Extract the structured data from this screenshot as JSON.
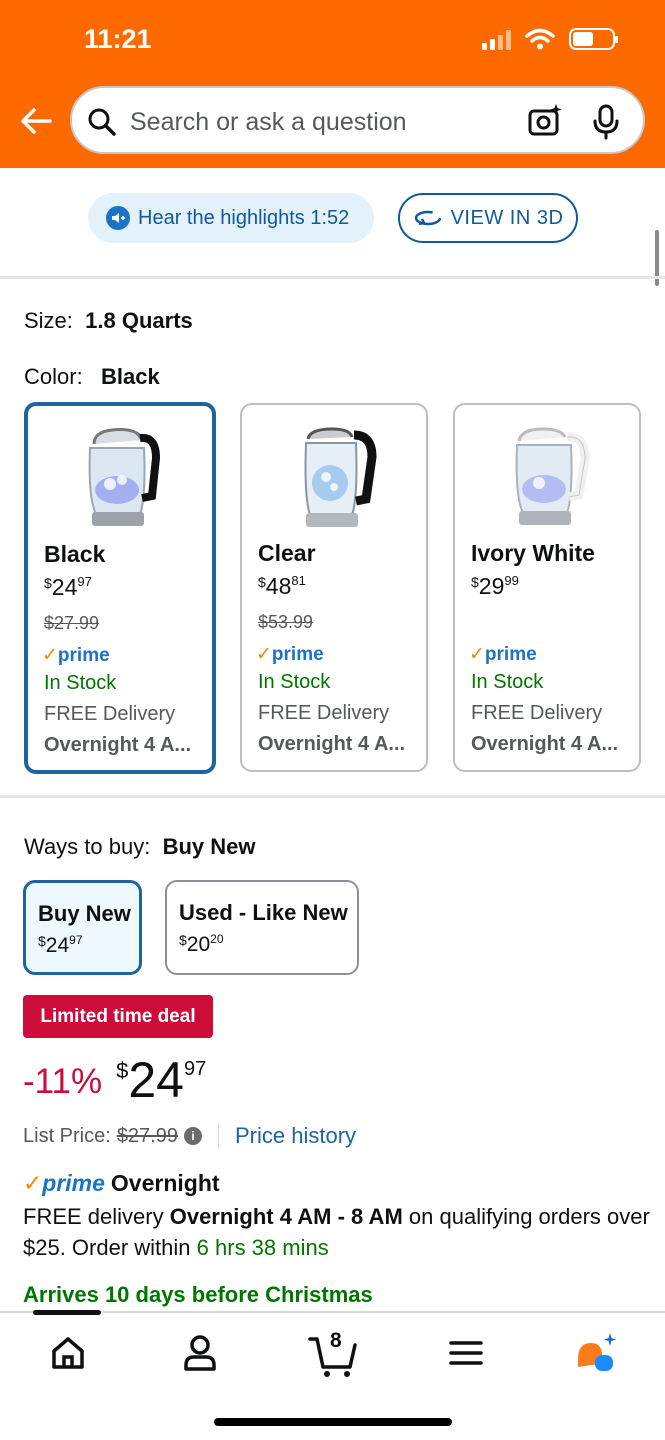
{
  "status_bar": {
    "time": "11:21"
  },
  "header": {
    "search_placeholder": "Search or ask a question",
    "icons": [
      "back-arrow-icon",
      "search-icon",
      "camera-search-icon",
      "microphone-icon"
    ],
    "background_color": "#ff6a00"
  },
  "actions": {
    "highlights_label": "Hear the highlights 1:52",
    "view3d_label": "VIEW IN 3D"
  },
  "size": {
    "label": "Size:",
    "value": "1.8 Quarts"
  },
  "color": {
    "label": "Color:",
    "value": "Black",
    "options": [
      {
        "name": "Black",
        "currency": "$",
        "price_whole": "24",
        "price_frac": "97",
        "list_price": "$27.99",
        "prime": "prime",
        "stock": "In Stock",
        "delivery": "FREE Delivery",
        "overnight": "Overnight 4 A...",
        "selected": true
      },
      {
        "name": "Clear",
        "currency": "$",
        "price_whole": "48",
        "price_frac": "81",
        "list_price": "$53.99",
        "prime": "prime",
        "stock": "In Stock",
        "delivery": "FREE Delivery",
        "overnight": "Overnight 4 A...",
        "selected": false
      },
      {
        "name": "Ivory White",
        "currency": "$",
        "price_whole": "29",
        "price_frac": "99",
        "list_price": "",
        "prime": "prime",
        "stock": "In Stock",
        "delivery": "FREE Delivery",
        "overnight": "Overnight 4 A...",
        "selected": false
      }
    ]
  },
  "ways_to_buy": {
    "label": "Ways to buy:",
    "value": "Buy New",
    "options": [
      {
        "title": "Buy New",
        "currency": "$",
        "price_whole": "24",
        "price_frac": "97",
        "selected": true
      },
      {
        "title": "Used - Like New",
        "currency": "$",
        "price_whole": "20",
        "price_frac": "20",
        "selected": false
      }
    ]
  },
  "deal": {
    "badge": "Limited time deal",
    "discount": "-11%",
    "currency": "$",
    "price_whole": "24",
    "price_frac": "97",
    "list_price_label": "List Price:",
    "list_price": "$27.99",
    "info_glyph": "i",
    "price_history": "Price history"
  },
  "delivery": {
    "prime_check": "✓",
    "prime_label": "prime",
    "prime_overnight": "Overnight",
    "line_prefix": "FREE delivery",
    "line_bold": "Overnight 4 AM - 8 AM",
    "line_suffix": "on qualifying orders over $25. Order within",
    "countdown": "6 hrs 38 mins",
    "arrives": "Arrives 10 days before Christmas"
  },
  "bottom_nav": {
    "cart_count": "8",
    "items": [
      "home-icon",
      "account-icon",
      "cart-icon",
      "menu-icon",
      "rufus-ai-icon"
    ]
  },
  "colors": {
    "accent_blue": "#2162a1",
    "deal_red": "#cc0c39",
    "stock_green": "#007600",
    "prime_orange": "#f08804"
  }
}
